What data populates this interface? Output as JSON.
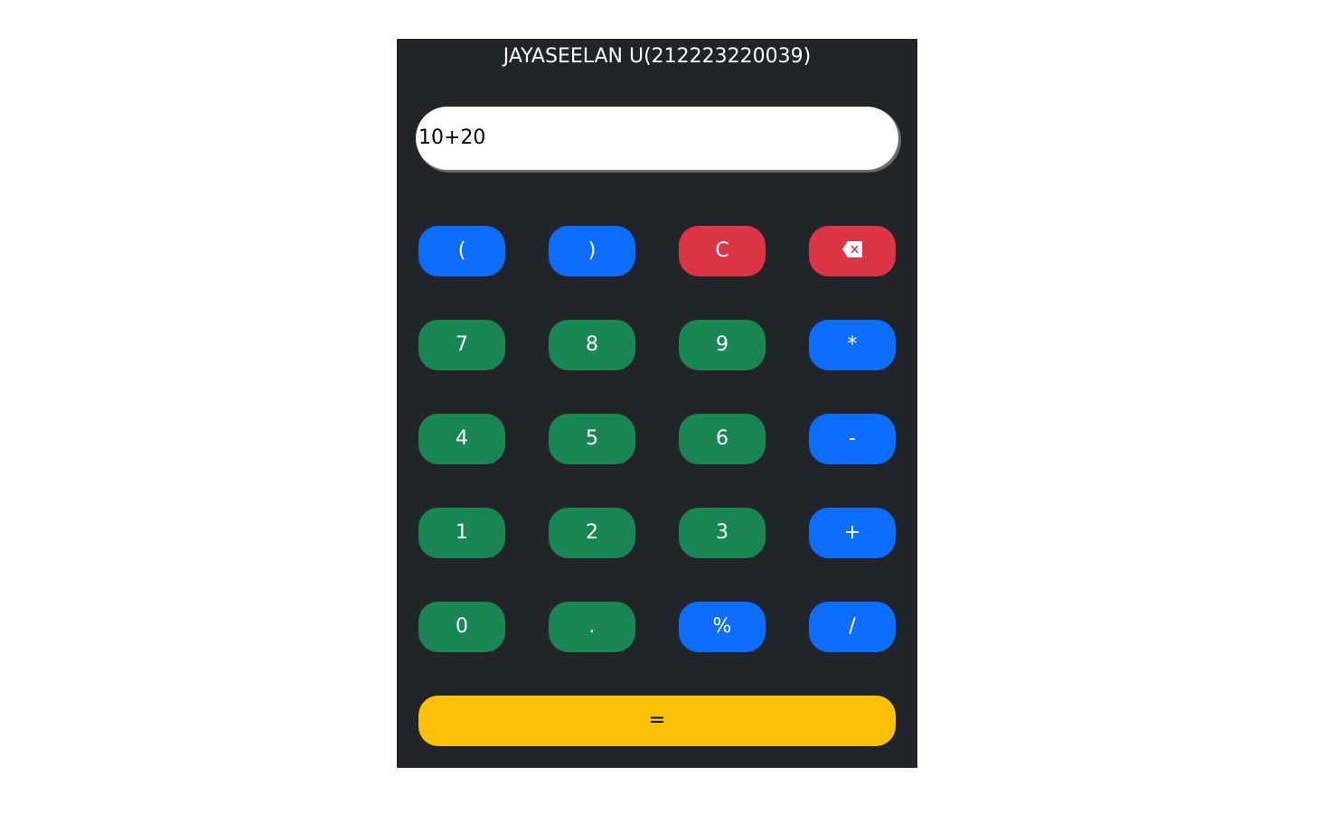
{
  "app": {
    "title": "JAYASEELAN U(212223220039)"
  },
  "display": {
    "value": "10+20"
  },
  "buttons": {
    "open_paren": "(",
    "close_paren": ")",
    "clear": "C",
    "backspace_icon": "backspace-icon",
    "seven": "7",
    "eight": "8",
    "nine": "9",
    "multiply": "*",
    "four": "4",
    "five": "5",
    "six": "6",
    "minus": "-",
    "one": "1",
    "two": "2",
    "three": "3",
    "plus": "+",
    "zero": "0",
    "dot": ".",
    "percent": "%",
    "divide": "/",
    "equals": "="
  },
  "colors": {
    "panel": "#212529",
    "operator": "#0d6efd",
    "digit": "#198754",
    "danger": "#dc3545",
    "equals": "#ffc107"
  }
}
